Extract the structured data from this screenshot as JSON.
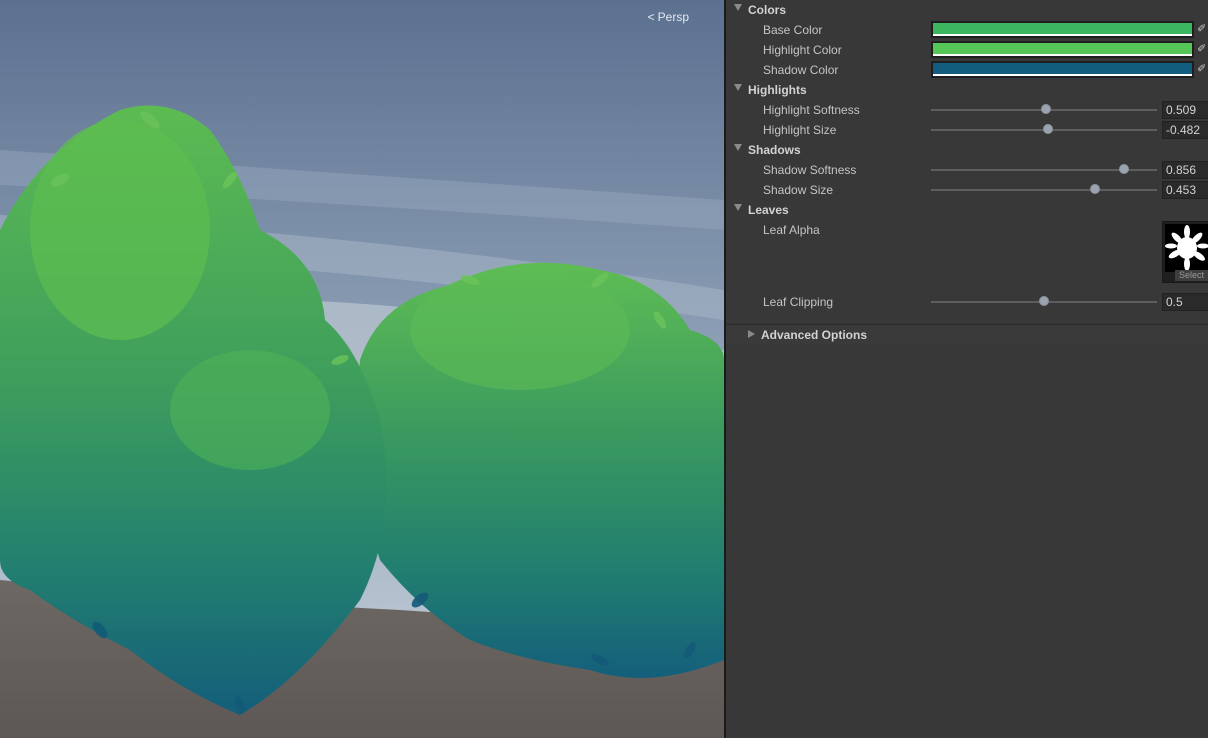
{
  "scene": {
    "camera_label": "Persp",
    "camera_icon": "perspective-icon"
  },
  "inspector": {
    "colors": {
      "title": "Colors",
      "items": [
        {
          "label": "Base Color",
          "color": "#3cb65f"
        },
        {
          "label": "Highlight Color",
          "color": "#55c657"
        },
        {
          "label": "Shadow Color",
          "color": "#125c7d"
        }
      ]
    },
    "highlights": {
      "title": "Highlights",
      "softness": {
        "label": "Highlight Softness",
        "value": "0.509",
        "fraction": 0.509
      },
      "size": {
        "label": "Highlight Size",
        "value": "-0.482",
        "fraction": 0.518
      }
    },
    "shadows": {
      "title": "Shadows",
      "softness": {
        "label": "Shadow Softness",
        "value": "0.856",
        "fraction": 0.856
      },
      "size": {
        "label": "Shadow Size",
        "value": "0.453",
        "fraction": 0.7265
      }
    },
    "leaves": {
      "title": "Leaves",
      "alpha_label": "Leaf Alpha",
      "select_label": "Select",
      "clipping": {
        "label": "Leaf Clipping",
        "value": "0.5",
        "fraction": 0.5
      }
    },
    "advanced": {
      "label": "Advanced Options"
    }
  }
}
